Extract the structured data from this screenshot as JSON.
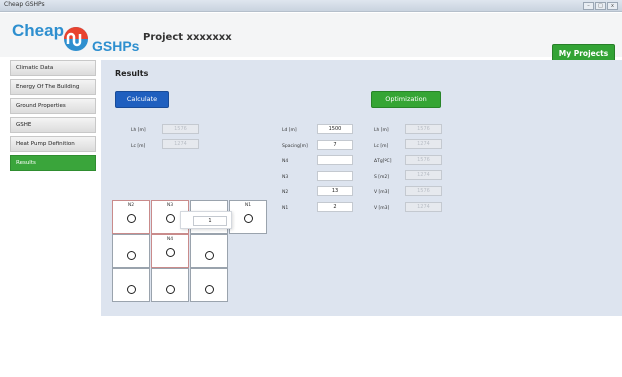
{
  "window": {
    "title": "Cheap GSHPs",
    "buttons": [
      "–",
      "□",
      "x"
    ]
  },
  "header": {
    "logo_top": "Cheap",
    "logo_bottom": "GSHPs",
    "project_title": "Project xxxxxxx",
    "my_projects_label": "My Projects"
  },
  "sidebar": {
    "items": [
      {
        "label": "Climatic Data",
        "active": false
      },
      {
        "label": "Energy Of The Building",
        "active": false
      },
      {
        "label": "Ground Properties",
        "active": false
      },
      {
        "label": "GSHE",
        "active": false
      },
      {
        "label": "Heat Pump Definition",
        "active": false
      },
      {
        "label": "Results",
        "active": true
      }
    ]
  },
  "main": {
    "title": "Results",
    "calculate_label": "Calculate",
    "optimization_label": "Optimization",
    "calc_fields": [
      {
        "label": "Lh [m]",
        "value": "1576"
      },
      {
        "label": "Lc [m]",
        "value": "1274"
      }
    ],
    "input_fields": [
      {
        "label": "Ld [m]",
        "value": "1500"
      },
      {
        "label": "Spacing[m]",
        "value": "7"
      },
      {
        "label": "N4",
        "value": ""
      },
      {
        "label": "N3",
        "value": ""
      },
      {
        "label": "N2",
        "value": "13"
      },
      {
        "label": "N1",
        "value": "2"
      }
    ],
    "opt_fields": [
      {
        "label": "Lh [m]",
        "value": "1576"
      },
      {
        "label": "Lc [m]",
        "value": "1274"
      },
      {
        "label": "ΔTg[ºC]",
        "value": "1576"
      },
      {
        "label": "S [m2]",
        "value": "1274"
      },
      {
        "label": "V [m3]",
        "value": "1576"
      },
      {
        "label": "V [m3]",
        "value": "1274"
      }
    ],
    "grid": {
      "cells": [
        {
          "label": "N2",
          "circle": true
        },
        {
          "label": "N3",
          "circle": true
        },
        {
          "label": "",
          "circle": false
        },
        {
          "label": "N1",
          "circle": true
        },
        {
          "label": "",
          "circle": true
        },
        {
          "label": "N4",
          "circle": true
        },
        {
          "label": "",
          "circle": true
        },
        {
          "label": "",
          "circle": false
        },
        {
          "label": "",
          "circle": true
        },
        {
          "label": "",
          "circle": true
        },
        {
          "label": "",
          "circle": true
        },
        {
          "label": "",
          "circle": false
        }
      ],
      "popup_value": "1"
    }
  }
}
